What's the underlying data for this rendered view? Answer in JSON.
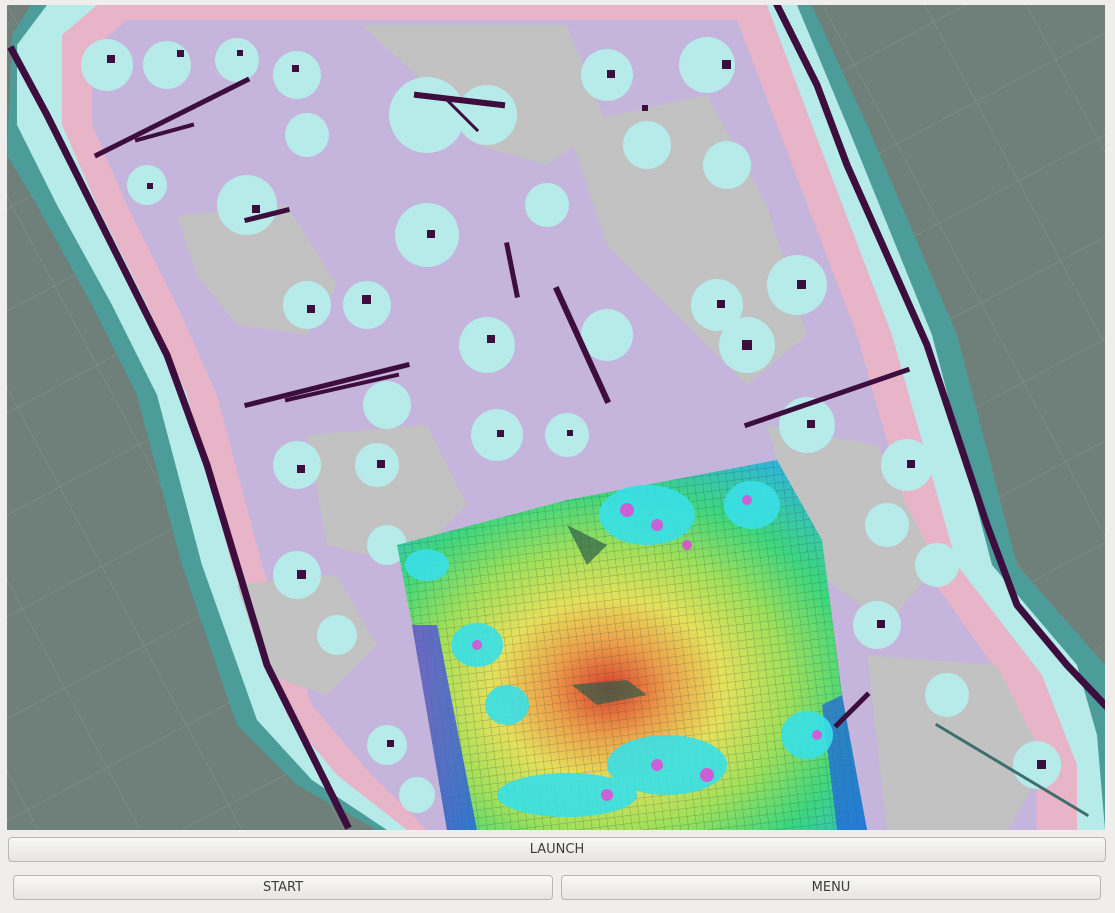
{
  "buttons": {
    "launch": "LAUNCH",
    "start": "START",
    "menu": "MENU"
  },
  "colors": {
    "viewport_background": "#6f807b",
    "unknown_space": "#c2c2c2",
    "inflated_zone": "#b6ebea",
    "cost_gradient_pink": "#e8b5c8",
    "cost_gradient_lavender": "#c5b4dc",
    "lethal_obstacle": "#3c0d3d",
    "costmap_outer_teal": "#4c9d9a"
  },
  "icons": [
    "obstacle-map",
    "local-costmap-heatmap"
  ]
}
